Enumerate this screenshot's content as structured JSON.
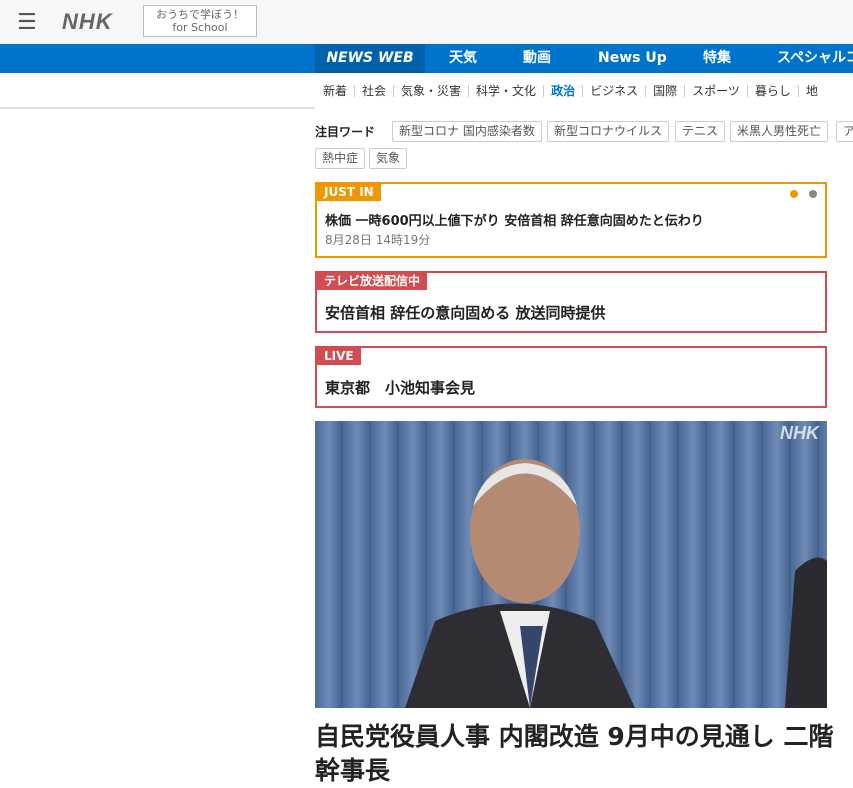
{
  "header": {
    "logo": "NHK",
    "school_line1": "おうちで学ぼう！",
    "school_line2": "for School"
  },
  "nav": {
    "items": [
      "NEWS WEB",
      "天気",
      "動画",
      "News Up",
      "特集",
      "スペシャルコ"
    ]
  },
  "subnav": {
    "items": [
      "新着",
      "社会",
      "気象・災害",
      "科学・文化",
      "政治",
      "ビジネス",
      "国際",
      "スポーツ",
      "暮らし",
      "地"
    ],
    "active": "政治"
  },
  "trending": {
    "label": "注目ワード",
    "tags": [
      "新型コロナ 国内感染者数",
      "新型コロナウイルス",
      "テニス",
      "米黒人男性死亡",
      "ア",
      "熱中症",
      "気象"
    ]
  },
  "just_in": {
    "badge": "JUST IN",
    "title": "株価 一時600円以上値下がり 安倍首相 辞任意向固めたと伝わり",
    "date": "8月28日 14時19分",
    "color": "#f29600"
  },
  "tv": {
    "badge": "テレビ放送配信中",
    "title": "安倍首相 辞任の意向固める 放送同時提供",
    "color": "#d14d52"
  },
  "live": {
    "badge": "LIVE",
    "title": "東京都　小池知事会見"
  },
  "top_story": {
    "watermark": "NHK",
    "headline": "自民党役員人事 内閣改造 9月中の見通し 二階幹事長"
  },
  "colors": {
    "brand": "#0074cc"
  }
}
